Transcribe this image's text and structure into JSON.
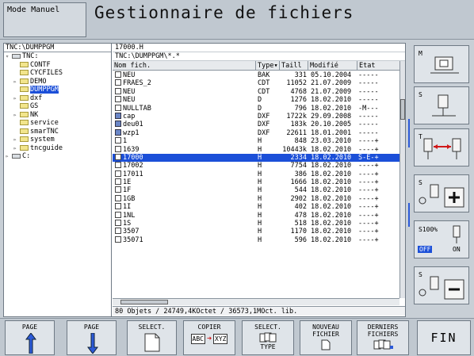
{
  "header": {
    "mode": "Mode Manuel",
    "title": "Gestionnaire de fichiers"
  },
  "tree": {
    "path": "TNC:\\DUMPPGM",
    "items": [
      {
        "label": "TNC:",
        "kind": "drive",
        "indent": 0,
        "expand": "▿"
      },
      {
        "label": "CONTF",
        "kind": "folder",
        "indent": 1,
        "expand": ""
      },
      {
        "label": "CYCFILES",
        "kind": "folder",
        "indent": 1,
        "expand": ""
      },
      {
        "label": "DEMO",
        "kind": "folder",
        "indent": 1,
        "expand": "▹"
      },
      {
        "label": "DUMPPGM",
        "kind": "folder",
        "indent": 1,
        "expand": "",
        "selected": true
      },
      {
        "label": "dxf",
        "kind": "folder",
        "indent": 1,
        "expand": "▹"
      },
      {
        "label": "GS",
        "kind": "folder",
        "indent": 1,
        "expand": ""
      },
      {
        "label": "NK",
        "kind": "folder",
        "indent": 1,
        "expand": "▹"
      },
      {
        "label": "service",
        "kind": "folder",
        "indent": 1,
        "expand": ""
      },
      {
        "label": "smarTNC",
        "kind": "folder",
        "indent": 1,
        "expand": ""
      },
      {
        "label": "system",
        "kind": "folder",
        "indent": 1,
        "expand": "▹"
      },
      {
        "label": "tncguide",
        "kind": "folder",
        "indent": 1,
        "expand": "▹"
      },
      {
        "label": "C:",
        "kind": "drive",
        "indent": 0,
        "expand": "▹"
      }
    ]
  },
  "files": {
    "selected_file": "17000.H",
    "filter_path": "TNC:\\DUMPPGM\\*.*",
    "columns": [
      "Nom fich.",
      "Type▾",
      "Taill",
      "Modifié",
      "Etat"
    ],
    "rows": [
      {
        "name": "NEU",
        "type": "BAK",
        "size": "331",
        "mod": "05.10.2004",
        "state": "-----",
        "icon": "doc"
      },
      {
        "name": "FRAES_2",
        "type": "CDT",
        "size": "11052",
        "mod": "21.07.2009",
        "state": "-----",
        "icon": "doc"
      },
      {
        "name": "NEU",
        "type": "CDT",
        "size": "4768",
        "mod": "21.07.2009",
        "state": "-----",
        "icon": "doc"
      },
      {
        "name": "NEU",
        "type": "D",
        "size": "1276",
        "mod": "18.02.2010",
        "state": "-----",
        "icon": "doc"
      },
      {
        "name": "NULLTAB",
        "type": "D",
        "size": "796",
        "mod": "18.02.2010",
        "state": "-M---",
        "icon": "doc"
      },
      {
        "name": "cap",
        "type": "DXF",
        "size": "1722k",
        "mod": "29.09.2008",
        "state": "-----",
        "icon": "dxf"
      },
      {
        "name": "deu01",
        "type": "DXF",
        "size": "183k",
        "mod": "20.10.2005",
        "state": "-----",
        "icon": "dxf"
      },
      {
        "name": "wzp1",
        "type": "DXF",
        "size": "22611",
        "mod": "18.01.2001",
        "state": "-----",
        "icon": "dxf"
      },
      {
        "name": "1",
        "type": "H",
        "size": "848",
        "mod": "23.03.2010",
        "state": "----+",
        "icon": "doc"
      },
      {
        "name": "1639",
        "type": "H",
        "size": "10443k",
        "mod": "18.02.2010",
        "state": "----+",
        "icon": "doc"
      },
      {
        "name": "17000",
        "type": "H",
        "size": "2334",
        "mod": "18.02.2010",
        "state": "S-E-+",
        "icon": "doc",
        "selected": true
      },
      {
        "name": "17002",
        "type": "H",
        "size": "7754",
        "mod": "18.02.2010",
        "state": "----+",
        "icon": "doc"
      },
      {
        "name": "17011",
        "type": "H",
        "size": "386",
        "mod": "18.02.2010",
        "state": "----+",
        "icon": "doc"
      },
      {
        "name": "1E",
        "type": "H",
        "size": "1666",
        "mod": "18.02.2010",
        "state": "----+",
        "icon": "doc"
      },
      {
        "name": "1F",
        "type": "H",
        "size": "544",
        "mod": "18.02.2010",
        "state": "----+",
        "icon": "doc"
      },
      {
        "name": "1GB",
        "type": "H",
        "size": "2902",
        "mod": "18.02.2010",
        "state": "----+",
        "icon": "doc"
      },
      {
        "name": "1I",
        "type": "H",
        "size": "402",
        "mod": "18.02.2010",
        "state": "----+",
        "icon": "doc"
      },
      {
        "name": "1NL",
        "type": "H",
        "size": "478",
        "mod": "18.02.2010",
        "state": "----+",
        "icon": "doc"
      },
      {
        "name": "1S",
        "type": "H",
        "size": "518",
        "mod": "18.02.2010",
        "state": "----+",
        "icon": "doc"
      },
      {
        "name": "3507",
        "type": "H",
        "size": "1170",
        "mod": "18.02.2010",
        "state": "----+",
        "icon": "doc"
      },
      {
        "name": "35071",
        "type": "H",
        "size": "596",
        "mod": "18.02.2010",
        "state": "----+",
        "icon": "doc"
      }
    ],
    "status": "80 Objets / 24749,4KOctet / 36573,1MOct. lib."
  },
  "side": {
    "m_label": "M",
    "s_label": "S",
    "t_label": "T",
    "s_plus_label": "S",
    "s100_label": "S100%",
    "off_label": "OFF",
    "on_label": "ON",
    "s_minus_label": "S"
  },
  "softkeys": {
    "page_up": "PAGE",
    "page_down": "PAGE",
    "select": "SELECT.",
    "copy": "COPIER",
    "copy_icon_from": "ABC",
    "copy_icon_to": "XYZ",
    "select_type_1": "SELECT.",
    "select_type_2": "TYPE",
    "new_file_1": "NOUVEAU",
    "new_file_2": "FICHIER",
    "last_files_1": "DERNIERS",
    "last_files_2": "FICHIERS",
    "fin": "FIN"
  },
  "colors": {
    "selection": "#1b4fd8",
    "accent": "#2c5ad8"
  }
}
